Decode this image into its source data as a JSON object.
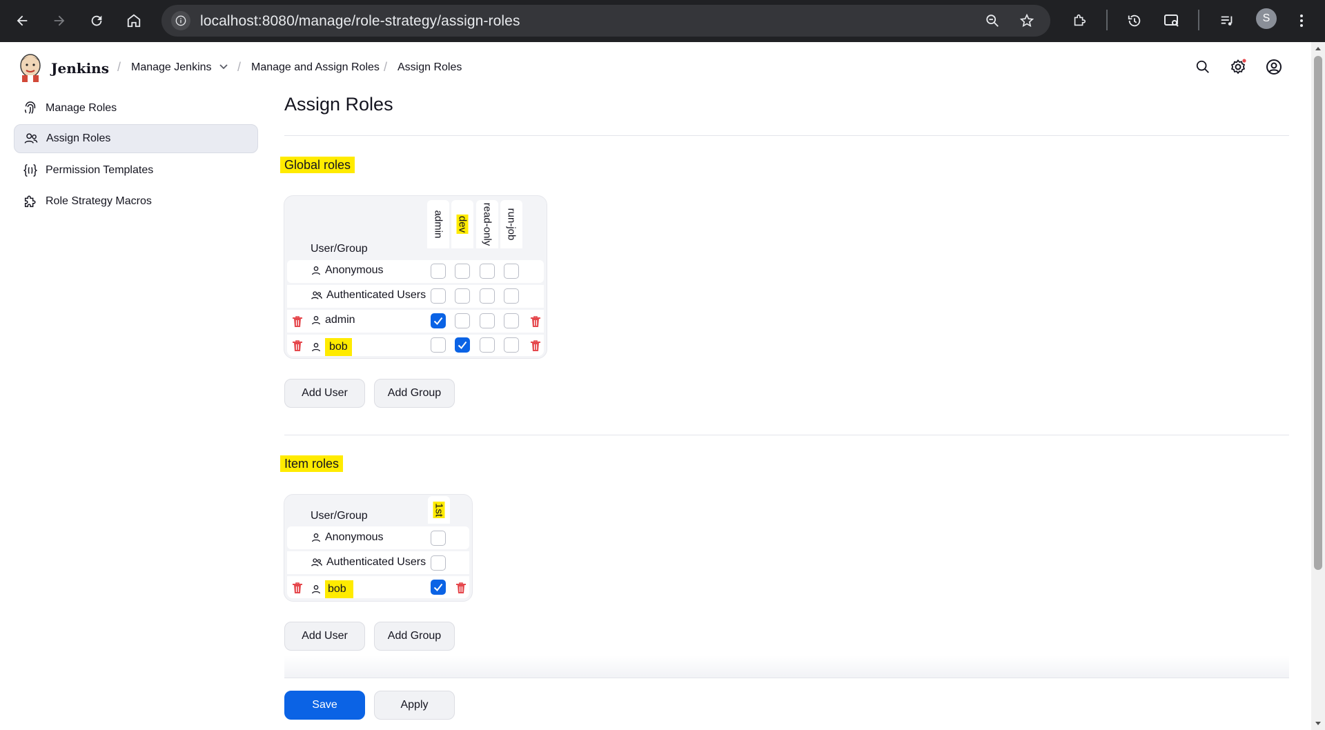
{
  "browser": {
    "url_host": "localhost",
    "url_path": ":8080/manage/role-strategy/assign-roles",
    "profile_initial": "S"
  },
  "header": {
    "brand": "Jenkins",
    "breadcrumbs": [
      "Manage Jenkins",
      "Manage and Assign Roles",
      "Assign Roles"
    ]
  },
  "sidebar": {
    "items": [
      {
        "label": "Manage Roles",
        "icon": "fingerprint-icon"
      },
      {
        "label": "Assign Roles",
        "icon": "users-icon",
        "active": true
      },
      {
        "label": "Permission Templates",
        "icon": "braces-icon"
      },
      {
        "label": "Role Strategy Macros",
        "icon": "puzzle-icon"
      }
    ]
  },
  "main": {
    "title": "Assign Roles",
    "global": {
      "title": "Global roles",
      "user_group_label": "User/Group",
      "columns": [
        "admin",
        "dev",
        "read-only",
        "run-job"
      ],
      "rows": [
        {
          "name": "Anonymous",
          "type": "user",
          "checks": [
            false,
            false,
            false,
            false
          ],
          "deletable": false
        },
        {
          "name": "Authenticated Users",
          "type": "group",
          "checks": [
            false,
            false,
            false,
            false
          ],
          "deletable": false
        },
        {
          "name": "admin",
          "type": "user",
          "checks": [
            true,
            false,
            false,
            false
          ],
          "deletable": true
        },
        {
          "name": "bob",
          "type": "user",
          "checks": [
            false,
            true,
            false,
            false
          ],
          "deletable": true
        }
      ],
      "add_user": "Add User",
      "add_group": "Add Group"
    },
    "item": {
      "title": "Item roles",
      "user_group_label": "User/Group",
      "columns": [
        "1st"
      ],
      "rows": [
        {
          "name": "Anonymous",
          "type": "user",
          "checks": [
            false
          ],
          "deletable": false
        },
        {
          "name": "Authenticated Users",
          "type": "group",
          "checks": [
            false
          ],
          "deletable": false
        },
        {
          "name": "bob",
          "type": "user",
          "checks": [
            true
          ],
          "deletable": true
        }
      ],
      "add_user": "Add User",
      "add_group": "Add Group"
    },
    "save": "Save",
    "apply": "Apply"
  },
  "colors": {
    "accent": "#0b63e5",
    "highlight": "#ffeb00",
    "danger": "#e5484d"
  }
}
